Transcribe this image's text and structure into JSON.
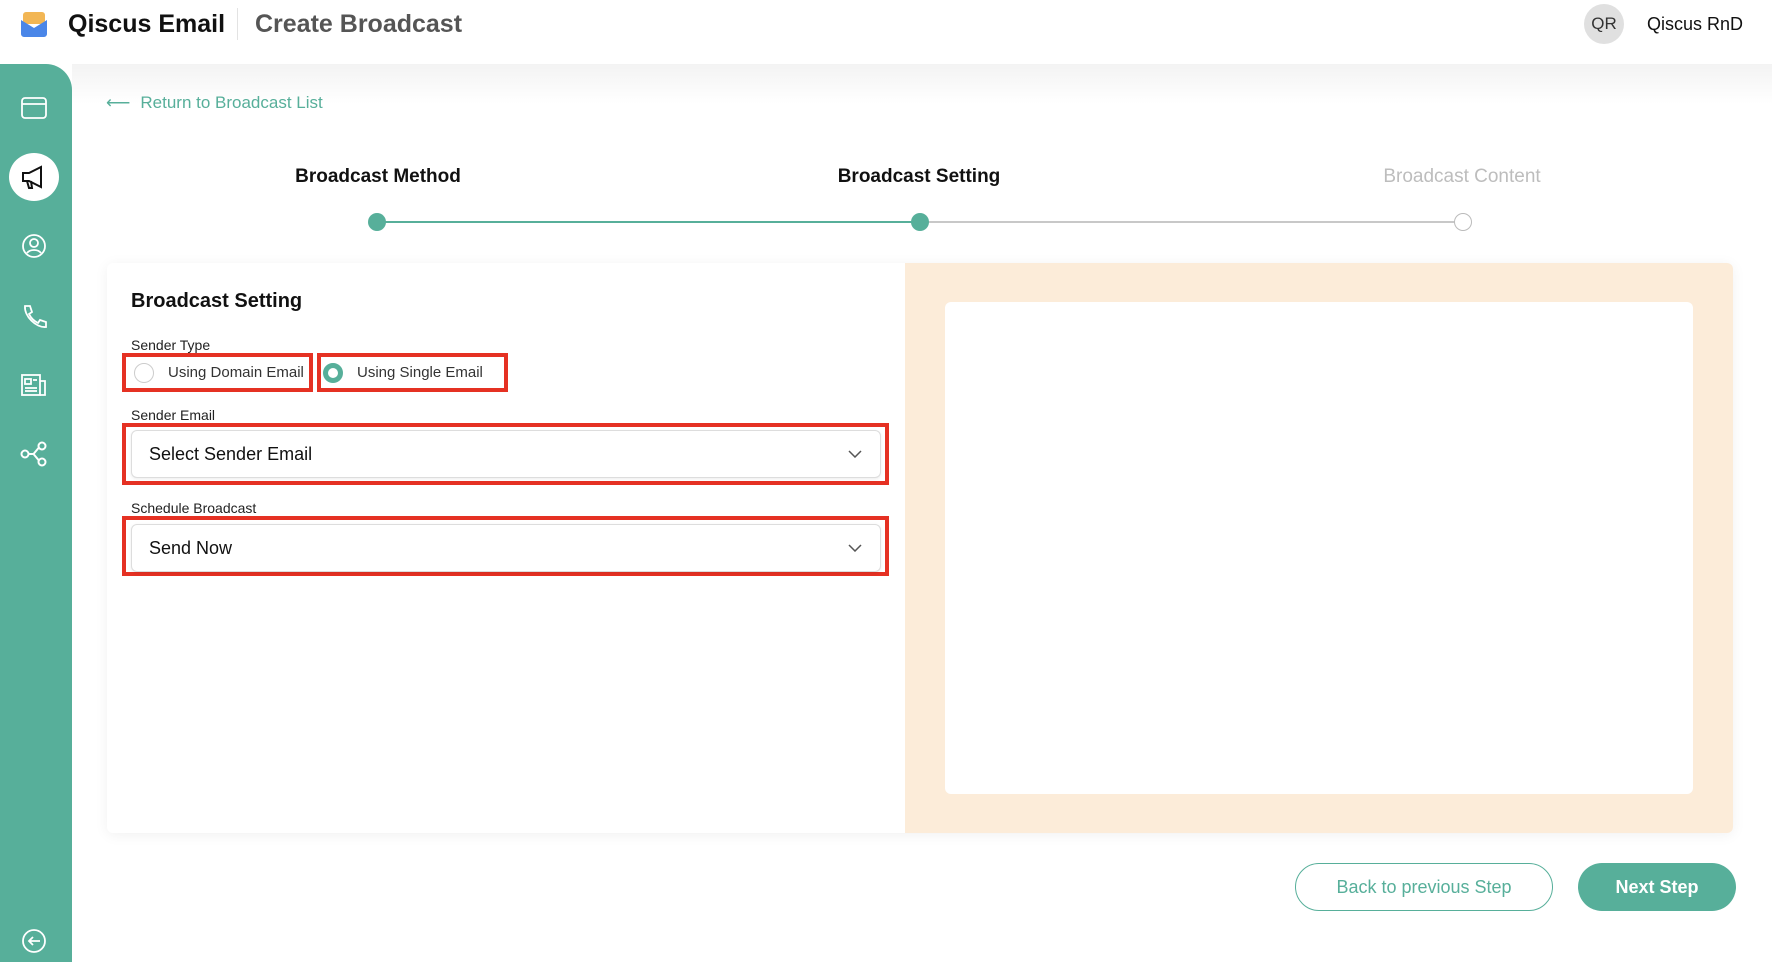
{
  "header": {
    "app_name": "Qiscus Email",
    "page_title": "Create Broadcast",
    "avatar_initials": "QR",
    "user_name": "Qiscus RnD"
  },
  "sidebar": {
    "items": [
      {
        "icon": "browser-window-icon"
      },
      {
        "icon": "megaphone-icon",
        "active": true
      },
      {
        "icon": "user-circle-icon"
      },
      {
        "icon": "phone-icon"
      },
      {
        "icon": "newspaper-icon"
      },
      {
        "icon": "share-nodes-icon"
      }
    ],
    "collapse_icon": "arrow-left-circle-icon"
  },
  "return_link": "Return to Broadcast List",
  "steps": [
    {
      "label": "Broadcast Method",
      "state": "done"
    },
    {
      "label": "Broadcast Setting",
      "state": "current"
    },
    {
      "label": "Broadcast Content",
      "state": "pending"
    }
  ],
  "form": {
    "heading": "Broadcast Setting",
    "sender_type_label": "Sender Type",
    "sender_type_options": [
      "Using Domain Email",
      "Using Single Email"
    ],
    "sender_type_selected": "Using Single Email",
    "sender_email_label": "Sender Email",
    "sender_email_placeholder": "Select Sender Email",
    "schedule_label": "Schedule Broadcast",
    "schedule_value": "Send Now"
  },
  "buttons": {
    "back": "Back to previous Step",
    "next": "Next Step"
  },
  "colors": {
    "accent": "#57af9a",
    "highlight": "#e53123",
    "preview_bg": "#fcecd9"
  }
}
